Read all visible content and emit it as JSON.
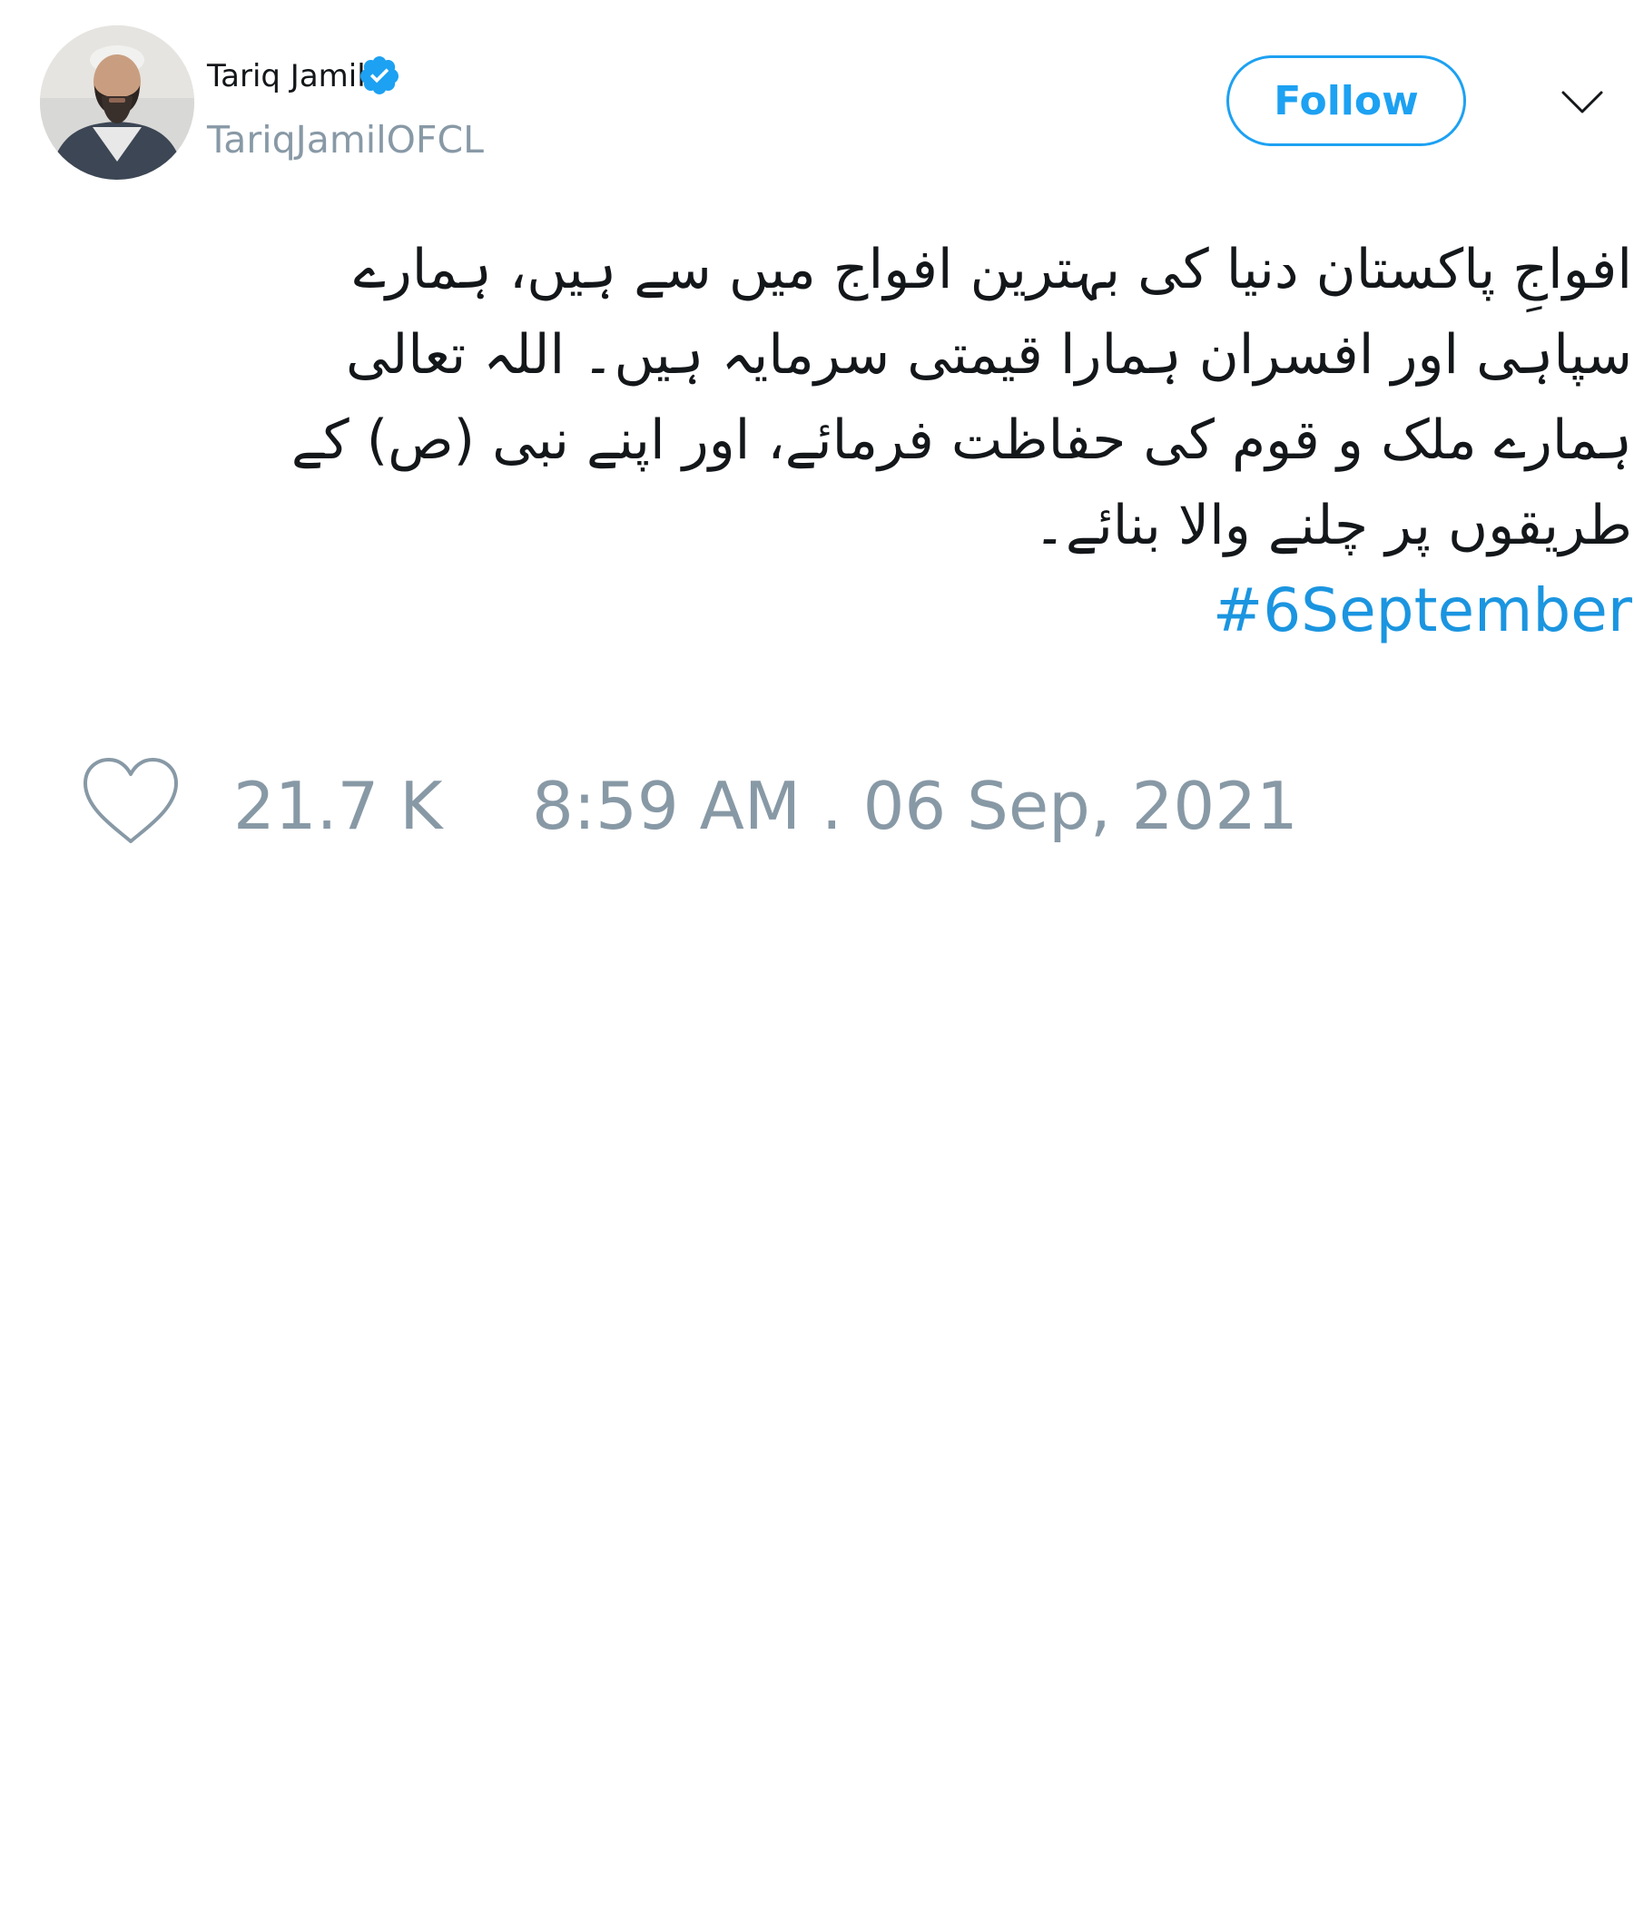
{
  "tweet": {
    "author": {
      "display_name": "Tariq Jamil",
      "handle": "TariqJamilOFCL",
      "verified": true
    },
    "follow_label": "Follow",
    "text_lines": [
      "افواجِ پاکستان دنیا کی بہترین افواج میں سے ہیں، ہمارے",
      "سپاہی اور افسران ہمارا قیمتی سرمایہ ہیں۔ اللہ تعالی",
      "ہمارے ملک و قوم کی حفاظت فرمائے، اور اپنے نبی (ص) کے",
      "طریقوں پر چلنے والا بنائے۔"
    ],
    "hashtag": "#6September",
    "like_count": "21.7 K",
    "timestamp": "8:59 AM . 06 Sep, 2021"
  },
  "colors": {
    "accent": "#1da1f2",
    "hashtag": "#1b95e0",
    "muted": "#8899a6",
    "text": "#14171a"
  },
  "icons": {
    "verified": "verified-badge-icon",
    "menu": "chevron-down-icon",
    "like": "heart-icon"
  }
}
